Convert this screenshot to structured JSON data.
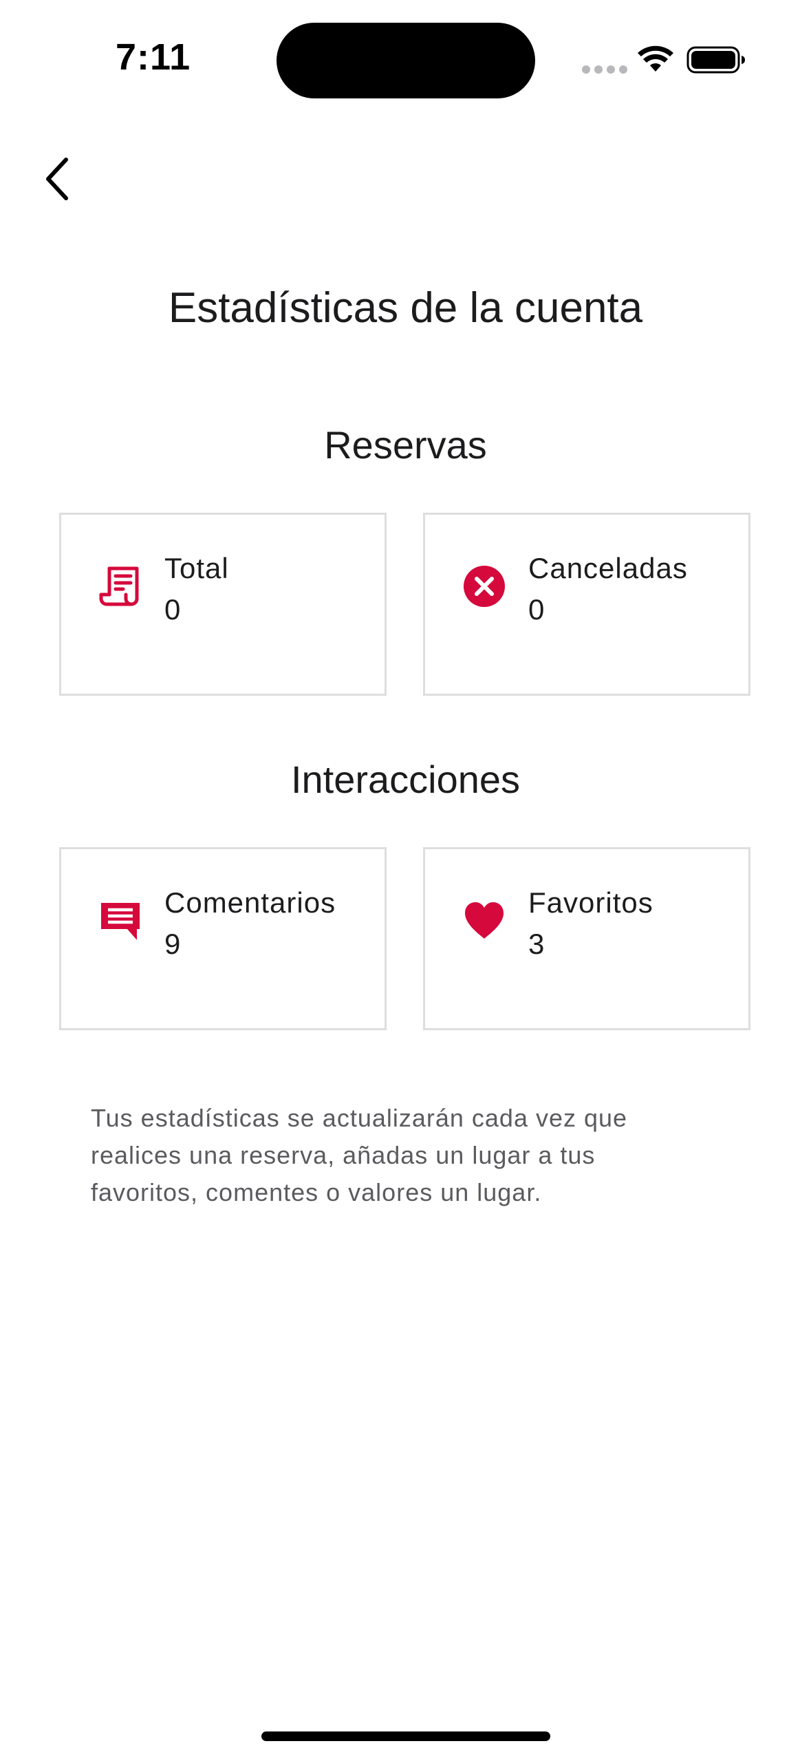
{
  "status_bar": {
    "time": "7:11"
  },
  "header": {
    "back_icon": "chevron-left-icon"
  },
  "page": {
    "title": "Estadísticas de la cuenta"
  },
  "sections": {
    "reservas": {
      "title": "Reservas",
      "cards": [
        {
          "label": "Total",
          "value": "0",
          "icon": "receipt-icon"
        },
        {
          "label": "Canceladas",
          "value": "0",
          "icon": "x-circle-icon"
        }
      ]
    },
    "interacciones": {
      "title": "Interacciones",
      "cards": [
        {
          "label": "Comentarios",
          "value": "9",
          "icon": "comment-icon"
        },
        {
          "label": "Favoritos",
          "value": "3",
          "icon": "heart-icon"
        }
      ]
    }
  },
  "info": {
    "text": "Tus estadísticas se actualizarán cada vez que realices una reserva, añadas un lugar a tus favoritos, comentes o valores un lugar."
  },
  "colors": {
    "accent": "#d5093c",
    "card_border": "#dedede",
    "text": "#1c1c1e",
    "muted_text": "#5b5b5f"
  }
}
